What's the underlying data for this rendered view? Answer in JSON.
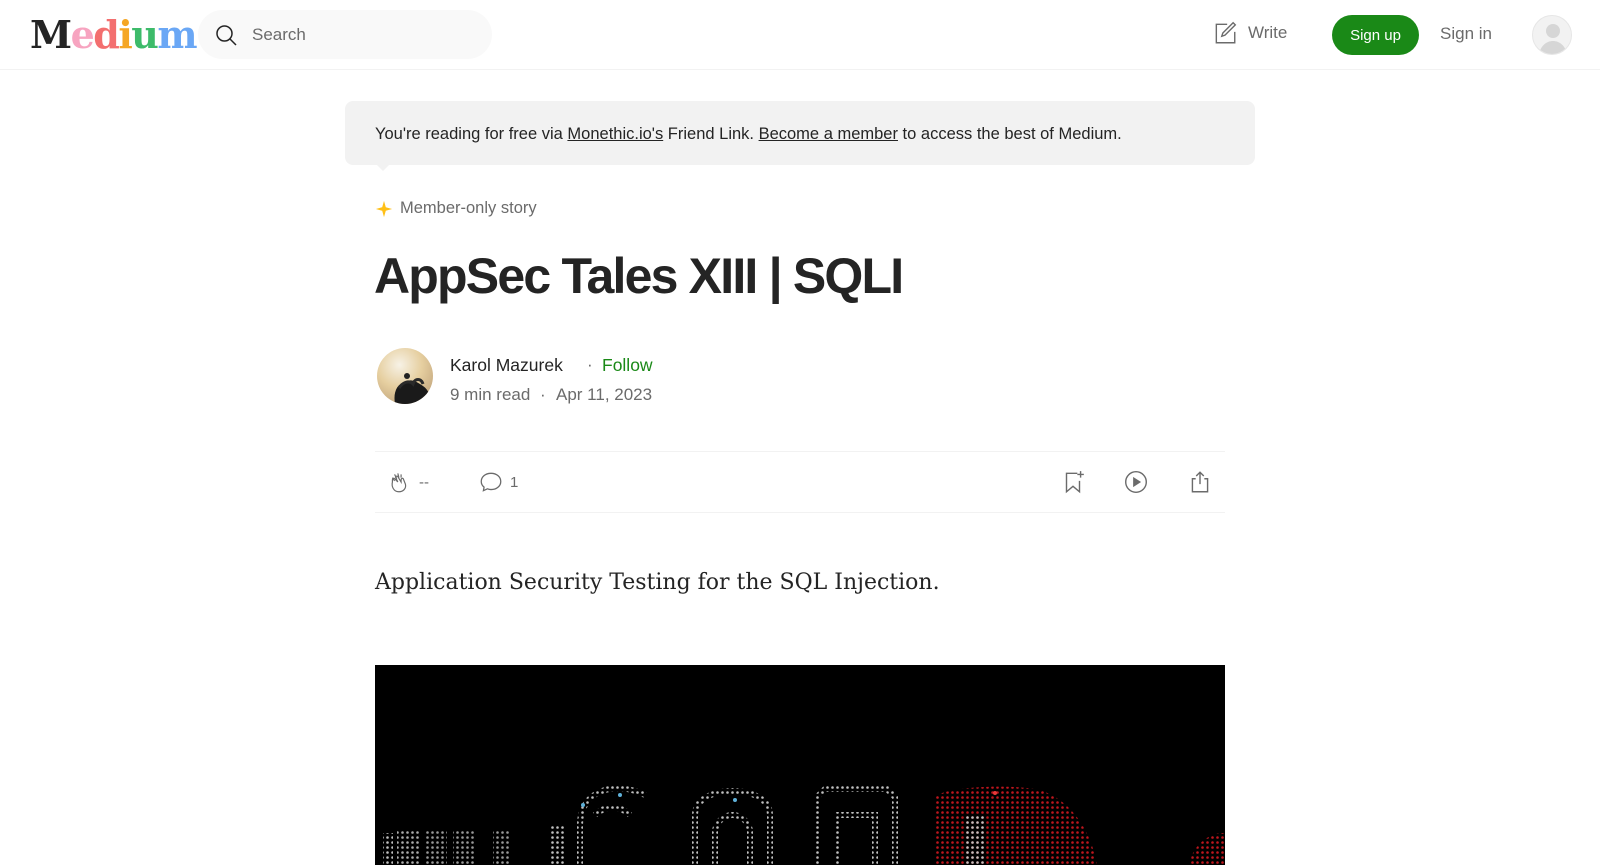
{
  "header": {
    "logo_text": "Medium",
    "search_placeholder": "Search",
    "write_label": "Write",
    "signup_label": "Sign up",
    "signin_label": "Sign in"
  },
  "banner": {
    "prefix": "You're reading for free via ",
    "publisher_link": "Monethic.io's",
    "middle": " Friend Link. ",
    "member_link": "Become a member",
    "suffix": " to access the best of Medium."
  },
  "member_badge": "Member-only story",
  "article": {
    "title": "AppSec Tales XIII | SQLI",
    "author": "Karol Mazurek",
    "separator": "·",
    "follow_label": "Follow",
    "read_time": "9 min read",
    "date": "Apr 11, 2023",
    "subtitle": "Application Security Testing for the SQL Injection."
  },
  "actions": {
    "claps": "--",
    "comments": "1"
  },
  "colors": {
    "brand_green": "#1a8917",
    "star": "#ffc017",
    "banner_bg": "#f2f2f2"
  }
}
